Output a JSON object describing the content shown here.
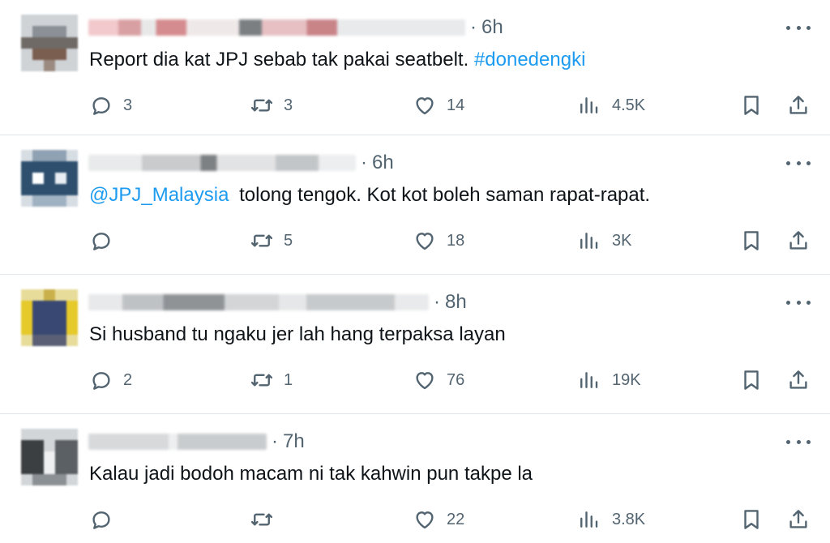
{
  "tweets": [
    {
      "time": "6h",
      "text": "Report dia kat JPJ sebab tak pakai seatbelt. ",
      "hashtag": "#donedengki",
      "mention": "",
      "counts": {
        "replies": "3",
        "reposts": "3",
        "likes": "14",
        "views": "4.5K"
      }
    },
    {
      "time": "6h",
      "text": " tolong tengok. Kot kot boleh saman rapat-rapat.",
      "hashtag": "",
      "mention": "@JPJ_Malaysia",
      "counts": {
        "replies": "",
        "reposts": "5",
        "likes": "18",
        "views": "3K"
      }
    },
    {
      "time": "8h",
      "text": "Si husband tu ngaku jer lah hang terpaksa layan",
      "hashtag": "",
      "mention": "",
      "counts": {
        "replies": "2",
        "reposts": "1",
        "likes": "76",
        "views": "19K"
      }
    },
    {
      "time": "7h",
      "text": "Kalau jadi bodoh macam ni tak kahwin pun takpe la",
      "hashtag": "",
      "mention": "",
      "counts": {
        "replies": "",
        "reposts": "",
        "likes": "22",
        "views": "3.8K"
      }
    }
  ],
  "separator": "·",
  "icons": [
    "reply-icon",
    "repost-icon",
    "like-icon",
    "views-icon",
    "bookmark-icon",
    "share-icon",
    "more-icon"
  ],
  "colors": {
    "link": "#1d9bf0",
    "secondary": "#536471",
    "text": "#0f1419",
    "divider": "#e1e6ea"
  }
}
